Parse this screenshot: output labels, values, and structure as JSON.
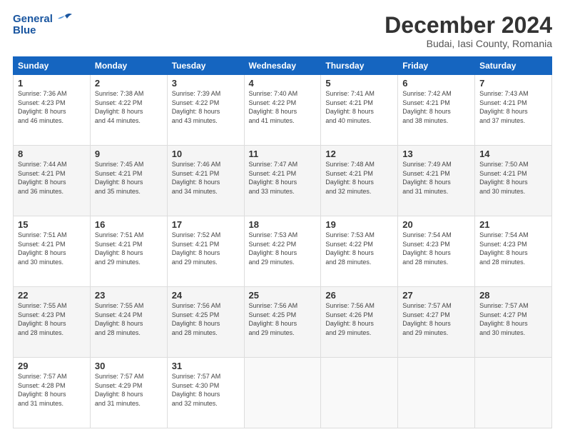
{
  "header": {
    "logo_line1": "General",
    "logo_line2": "Blue",
    "title": "December 2024",
    "subtitle": "Budai, Iasi County, Romania"
  },
  "weekdays": [
    "Sunday",
    "Monday",
    "Tuesday",
    "Wednesday",
    "Thursday",
    "Friday",
    "Saturday"
  ],
  "weeks": [
    [
      {
        "num": "1",
        "rise": "7:36 AM",
        "set": "4:23 PM",
        "daylight": "8 hours and 46 minutes."
      },
      {
        "num": "2",
        "rise": "7:38 AM",
        "set": "4:22 PM",
        "daylight": "8 hours and 44 minutes."
      },
      {
        "num": "3",
        "rise": "7:39 AM",
        "set": "4:22 PM",
        "daylight": "8 hours and 43 minutes."
      },
      {
        "num": "4",
        "rise": "7:40 AM",
        "set": "4:22 PM",
        "daylight": "8 hours and 41 minutes."
      },
      {
        "num": "5",
        "rise": "7:41 AM",
        "set": "4:21 PM",
        "daylight": "8 hours and 40 minutes."
      },
      {
        "num": "6",
        "rise": "7:42 AM",
        "set": "4:21 PM",
        "daylight": "8 hours and 38 minutes."
      },
      {
        "num": "7",
        "rise": "7:43 AM",
        "set": "4:21 PM",
        "daylight": "8 hours and 37 minutes."
      }
    ],
    [
      {
        "num": "8",
        "rise": "7:44 AM",
        "set": "4:21 PM",
        "daylight": "8 hours and 36 minutes."
      },
      {
        "num": "9",
        "rise": "7:45 AM",
        "set": "4:21 PM",
        "daylight": "8 hours and 35 minutes."
      },
      {
        "num": "10",
        "rise": "7:46 AM",
        "set": "4:21 PM",
        "daylight": "8 hours and 34 minutes."
      },
      {
        "num": "11",
        "rise": "7:47 AM",
        "set": "4:21 PM",
        "daylight": "8 hours and 33 minutes."
      },
      {
        "num": "12",
        "rise": "7:48 AM",
        "set": "4:21 PM",
        "daylight": "8 hours and 32 minutes."
      },
      {
        "num": "13",
        "rise": "7:49 AM",
        "set": "4:21 PM",
        "daylight": "8 hours and 31 minutes."
      },
      {
        "num": "14",
        "rise": "7:50 AM",
        "set": "4:21 PM",
        "daylight": "8 hours and 30 minutes."
      }
    ],
    [
      {
        "num": "15",
        "rise": "7:51 AM",
        "set": "4:21 PM",
        "daylight": "8 hours and 30 minutes."
      },
      {
        "num": "16",
        "rise": "7:51 AM",
        "set": "4:21 PM",
        "daylight": "8 hours and 29 minutes."
      },
      {
        "num": "17",
        "rise": "7:52 AM",
        "set": "4:21 PM",
        "daylight": "8 hours and 29 minutes."
      },
      {
        "num": "18",
        "rise": "7:53 AM",
        "set": "4:22 PM",
        "daylight": "8 hours and 29 minutes."
      },
      {
        "num": "19",
        "rise": "7:53 AM",
        "set": "4:22 PM",
        "daylight": "8 hours and 28 minutes."
      },
      {
        "num": "20",
        "rise": "7:54 AM",
        "set": "4:23 PM",
        "daylight": "8 hours and 28 minutes."
      },
      {
        "num": "21",
        "rise": "7:54 AM",
        "set": "4:23 PM",
        "daylight": "8 hours and 28 minutes."
      }
    ],
    [
      {
        "num": "22",
        "rise": "7:55 AM",
        "set": "4:23 PM",
        "daylight": "8 hours and 28 minutes."
      },
      {
        "num": "23",
        "rise": "7:55 AM",
        "set": "4:24 PM",
        "daylight": "8 hours and 28 minutes."
      },
      {
        "num": "24",
        "rise": "7:56 AM",
        "set": "4:25 PM",
        "daylight": "8 hours and 28 minutes."
      },
      {
        "num": "25",
        "rise": "7:56 AM",
        "set": "4:25 PM",
        "daylight": "8 hours and 29 minutes."
      },
      {
        "num": "26",
        "rise": "7:56 AM",
        "set": "4:26 PM",
        "daylight": "8 hours and 29 minutes."
      },
      {
        "num": "27",
        "rise": "7:57 AM",
        "set": "4:27 PM",
        "daylight": "8 hours and 29 minutes."
      },
      {
        "num": "28",
        "rise": "7:57 AM",
        "set": "4:27 PM",
        "daylight": "8 hours and 30 minutes."
      }
    ],
    [
      {
        "num": "29",
        "rise": "7:57 AM",
        "set": "4:28 PM",
        "daylight": "8 hours and 31 minutes."
      },
      {
        "num": "30",
        "rise": "7:57 AM",
        "set": "4:29 PM",
        "daylight": "8 hours and 31 minutes."
      },
      {
        "num": "31",
        "rise": "7:57 AM",
        "set": "4:30 PM",
        "daylight": "8 hours and 32 minutes."
      },
      null,
      null,
      null,
      null
    ]
  ]
}
